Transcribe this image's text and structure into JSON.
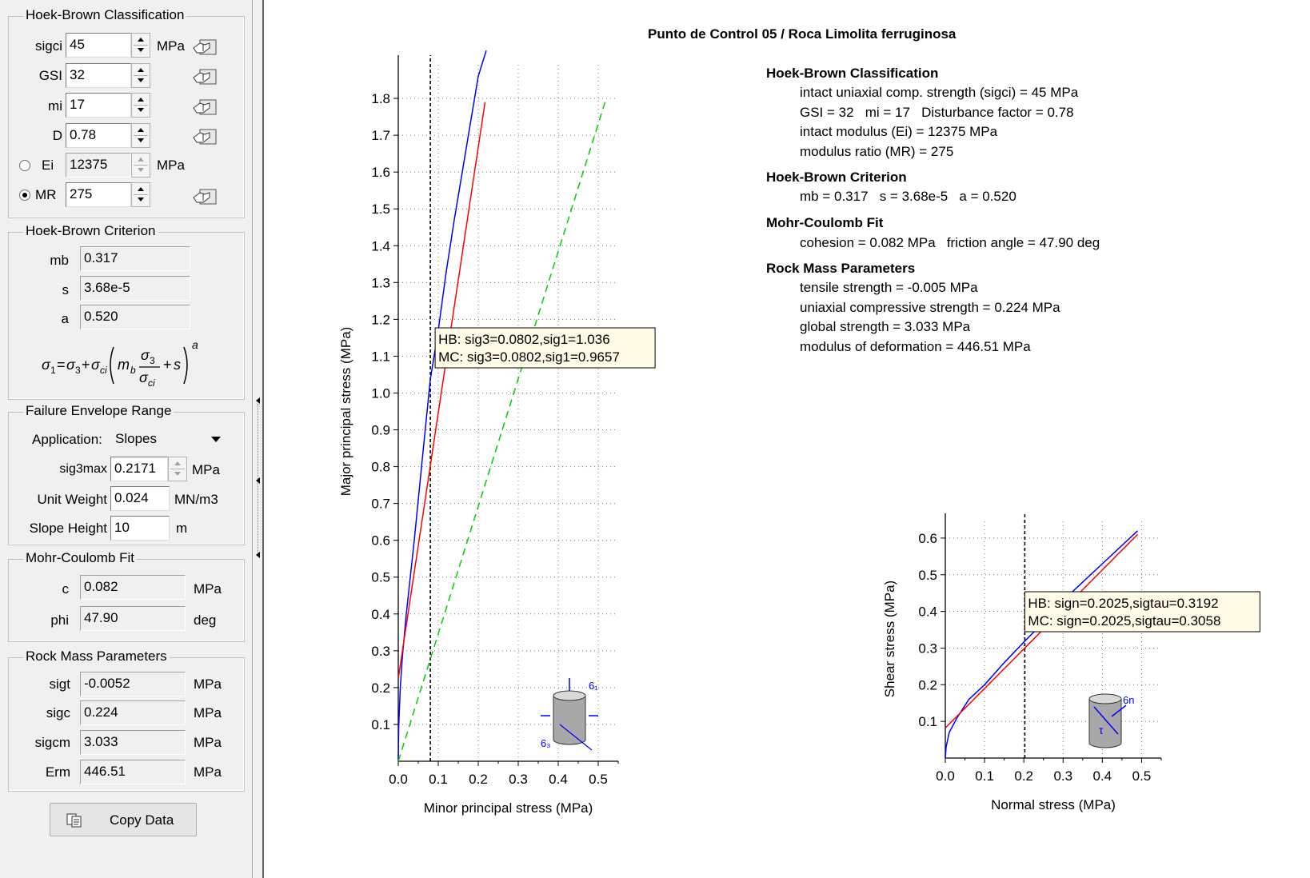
{
  "hb_classification": {
    "title": "Hoek-Brown Classification",
    "sigci_label": "sigci",
    "sigci_value": "45",
    "sigci_unit": "MPa",
    "gsi_label": "GSI",
    "gsi_value": "32",
    "mi_label": "mi",
    "mi_value": "17",
    "d_label": "D",
    "d_value": "0.78",
    "ei_label": "Ei",
    "ei_value": "12375",
    "ei_unit": "MPa",
    "mr_label": "MR",
    "mr_value": "275",
    "mode_selected": "MR"
  },
  "hb_criterion": {
    "title": "Hoek-Brown Criterion",
    "mb_label": "mb",
    "mb_value": "0.317",
    "s_label": "s",
    "s_value": "3.68e-5",
    "a_label": "a",
    "a_value": "0.520"
  },
  "envelope": {
    "title": "Failure Envelope Range",
    "application_label": "Application:",
    "application_value": "Slopes",
    "sig3max_label": "sig3max",
    "sig3max_value": "0.2171",
    "sig3max_unit": "MPa",
    "unit_weight_label": "Unit Weight",
    "unit_weight_value": "0.024",
    "unit_weight_unit": "MN/m3",
    "slope_height_label": "Slope Height",
    "slope_height_value": "10",
    "slope_height_unit": "m"
  },
  "mc_fit": {
    "title": "Mohr-Coulomb Fit",
    "c_label": "c",
    "c_value": "0.082",
    "c_unit": "MPa",
    "phi_label": "phi",
    "phi_value": "47.90",
    "phi_unit": "deg"
  },
  "rock_mass": {
    "title": "Rock Mass Parameters",
    "sigt_label": "sigt",
    "sigt_value": "-0.0052",
    "sigt_unit": "MPa",
    "sigc_label": "sigc",
    "sigc_value": "0.224",
    "sigc_unit": "MPa",
    "sigcm_label": "sigcm",
    "sigcm_value": "3.033",
    "sigcm_unit": "MPa",
    "erm_label": "Erm",
    "erm_value": "446.51",
    "erm_unit": "MPa"
  },
  "copy_button_label": "Copy Data",
  "plot_title": "Punto de Control 05 / Roca Limolita ferruginosa",
  "info": {
    "h1": "Hoek-Brown Classification",
    "l1": "intact uniaxial comp. strength (sigci) = 45 MPa",
    "l2": "GSI = 32   mi = 17   Disturbance factor = 0.78",
    "l3": "intact modulus (Ei) = 12375 MPa",
    "l4": "modulus ratio (MR) = 275",
    "h2": "Hoek-Brown Criterion",
    "l5": "mb = 0.317   s = 3.68e-5   a = 0.520",
    "h3": "Mohr-Coulomb Fit",
    "l6": "cohesion = 0.082 MPa   friction angle = 47.90 deg",
    "h4": "Rock Mass Parameters",
    "l7": "tensile strength = -0.005 MPa",
    "l8": "uniaxial compressive strength = 0.224 MPa",
    "l9": "global strength = 3.033 MPa",
    "l10": "modulus of deformation = 446.51 MPa"
  },
  "colors": {
    "hb": "#0000ff",
    "mc": "#ff0000",
    "ref": "#00cc00",
    "tooltip_bg": "#fffbe6"
  },
  "chart_data": [
    {
      "type": "line",
      "xlabel": "Minor principal stress (MPa)",
      "ylabel": "Major principal stress (MPa)",
      "xlim": [
        0,
        0.55
      ],
      "ylim": [
        0,
        1.9
      ],
      "x_ticks": [
        "0.0",
        "0.1",
        "0.2",
        "0.3",
        "0.4",
        "0.5"
      ],
      "y_ticks": [
        "0.1",
        "0.2",
        "0.3",
        "0.4",
        "0.5",
        "0.6",
        "0.7",
        "0.8",
        "0.9",
        "1.0",
        "1.1",
        "1.2",
        "1.3",
        "1.4",
        "1.5",
        "1.6",
        "1.7",
        "1.8"
      ],
      "cursor_x": 0.0802,
      "tooltip": [
        "HB: sig3=0.0802,sig1=1.036",
        "MC: sig3=0.0802,sig1=0.9657"
      ],
      "icon_labels": [
        "6₁",
        "6₃"
      ],
      "series": [
        {
          "key": "hb",
          "x": [
            0,
            0.001,
            0.005,
            0.01,
            0.02,
            0.04,
            0.06,
            0.08,
            0.1,
            0.12,
            0.14,
            0.16,
            0.18,
            0.2,
            0.22
          ],
          "y": [
            0.0,
            0.09,
            0.2,
            0.28,
            0.4,
            0.6,
            0.82,
            1.036,
            1.17,
            1.33,
            1.47,
            1.6,
            1.73,
            1.86,
            1.93
          ]
        },
        {
          "key": "mc",
          "x": [
            0,
            0.2171
          ],
          "y": [
            0.225,
            1.79
          ]
        },
        {
          "key": "ref",
          "x": [
            0,
            0.52
          ],
          "y": [
            0,
            1.8
          ]
        }
      ]
    },
    {
      "type": "line",
      "xlabel": "Normal stress (MPa)",
      "ylabel": "Shear stress (MPa)",
      "xlim": [
        0,
        0.55
      ],
      "ylim": [
        0,
        0.65
      ],
      "x_ticks": [
        "0.0",
        "0.1",
        "0.2",
        "0.3",
        "0.4",
        "0.5"
      ],
      "y_ticks": [
        "0.1",
        "0.2",
        "0.3",
        "0.4",
        "0.5",
        "0.6"
      ],
      "cursor_x": 0.2025,
      "tooltip": [
        "HB: sign=0.2025,sigtau=0.3192",
        "MC: sign=0.2025,sigtau=0.3058"
      ],
      "icon_labels": [
        "6n",
        "τ"
      ],
      "series": [
        {
          "key": "hb",
          "x": [
            0,
            0.002,
            0.01,
            0.03,
            0.06,
            0.1,
            0.15,
            0.2025,
            0.25,
            0.3,
            0.35,
            0.4,
            0.45,
            0.49
          ],
          "y": [
            0.0,
            0.03,
            0.07,
            0.11,
            0.16,
            0.2,
            0.26,
            0.3192,
            0.37,
            0.43,
            0.48,
            0.53,
            0.58,
            0.62
          ]
        },
        {
          "key": "mc",
          "x": [
            0,
            0.49
          ],
          "y": [
            0.082,
            0.61
          ]
        }
      ]
    }
  ]
}
